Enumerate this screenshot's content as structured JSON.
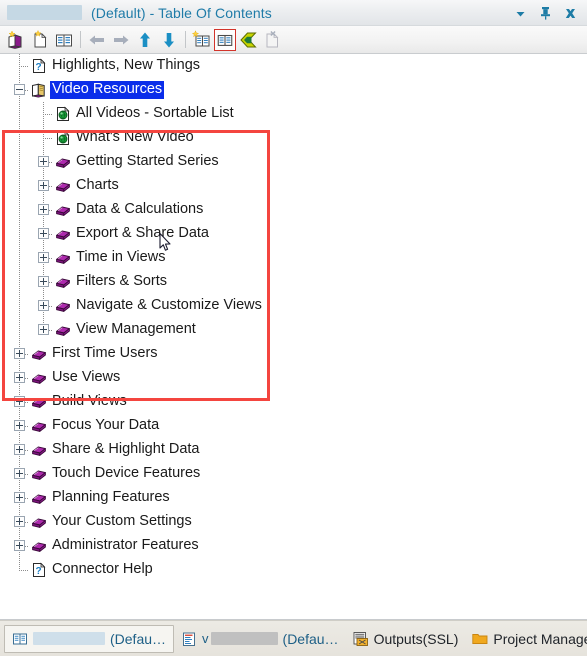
{
  "window": {
    "title_suffix": "(Default) - Table Of Contents",
    "redacted_title": "",
    "controls": [
      {
        "name": "dropdown-menu",
        "label": "Window menu"
      },
      {
        "name": "auto-hide-pin",
        "label": "Auto Hide"
      },
      {
        "name": "close",
        "label": "Close"
      }
    ]
  },
  "toolbar": {
    "items": [
      {
        "name": "new-book-icon",
        "label": "New Book",
        "enabled": true
      },
      {
        "name": "new-page-icon",
        "label": "New Page",
        "enabled": true
      },
      {
        "name": "show-contents-icon",
        "label": "Show Contents",
        "enabled": true
      },
      {
        "name": "back-arrow-icon",
        "label": "Back",
        "enabled": false
      },
      {
        "name": "forward-arrow-icon",
        "label": "Forward",
        "enabled": false
      },
      {
        "name": "move-up-icon",
        "label": "Move Up",
        "enabled": true
      },
      {
        "name": "move-down-icon",
        "label": "Move Down",
        "enabled": true
      },
      {
        "name": "new-topic-icon",
        "label": "New Topic",
        "enabled": true
      },
      {
        "name": "toggle-book-icon",
        "label": "Synchronize Contents",
        "enabled": true,
        "active": true
      },
      {
        "name": "bookmark-icon",
        "label": "Bookmark",
        "enabled": true
      },
      {
        "name": "delete-page-icon",
        "label": "Delete Page",
        "enabled": false
      }
    ]
  },
  "tree": {
    "nodes": [
      {
        "label": "Highlights, New Things",
        "icon": "help-page-icon",
        "depth": 0,
        "state": "leaf",
        "selected": false
      },
      {
        "label": "Video Resources",
        "icon": "open-book-icon",
        "depth": 0,
        "state": "expanded",
        "selected": true
      },
      {
        "label": "All Videos - Sortable List",
        "icon": "globe-page-icon",
        "depth": 1,
        "state": "leaf",
        "selected": false
      },
      {
        "label": "What's New Video",
        "icon": "globe-page-icon",
        "depth": 1,
        "state": "leaf",
        "selected": false
      },
      {
        "label": "Getting Started Series",
        "icon": "book-icon",
        "depth": 1,
        "state": "collapsed",
        "selected": false
      },
      {
        "label": "Charts",
        "icon": "book-icon",
        "depth": 1,
        "state": "collapsed",
        "selected": false
      },
      {
        "label": "Data & Calculations",
        "icon": "book-icon",
        "depth": 1,
        "state": "collapsed",
        "selected": false
      },
      {
        "label": "Export & Share Data",
        "icon": "book-icon",
        "depth": 1,
        "state": "collapsed",
        "selected": false
      },
      {
        "label": "Time in Views",
        "icon": "book-icon",
        "depth": 1,
        "state": "collapsed",
        "selected": false
      },
      {
        "label": "Filters & Sorts",
        "icon": "book-icon",
        "depth": 1,
        "state": "collapsed",
        "selected": false
      },
      {
        "label": "Navigate & Customize Views",
        "icon": "book-icon",
        "depth": 1,
        "state": "collapsed",
        "selected": false
      },
      {
        "label": "View Management",
        "icon": "book-icon",
        "depth": 1,
        "state": "collapsed",
        "selected": false
      },
      {
        "label": "First Time Users",
        "icon": "book-icon",
        "depth": 0,
        "state": "collapsed",
        "selected": false
      },
      {
        "label": "Use Views",
        "icon": "book-icon",
        "depth": 0,
        "state": "collapsed",
        "selected": false
      },
      {
        "label": "Build Views",
        "icon": "book-icon",
        "depth": 0,
        "state": "collapsed",
        "selected": false
      },
      {
        "label": "Focus Your Data",
        "icon": "book-icon",
        "depth": 0,
        "state": "collapsed",
        "selected": false
      },
      {
        "label": "Share & Highlight Data",
        "icon": "book-icon",
        "depth": 0,
        "state": "collapsed",
        "selected": false
      },
      {
        "label": "Touch Device Features",
        "icon": "book-icon",
        "depth": 0,
        "state": "collapsed",
        "selected": false
      },
      {
        "label": "Planning Features",
        "icon": "book-icon",
        "depth": 0,
        "state": "collapsed",
        "selected": false
      },
      {
        "label": "Your Custom Settings",
        "icon": "book-icon",
        "depth": 0,
        "state": "collapsed",
        "selected": false
      },
      {
        "label": "Administrator Features",
        "icon": "book-icon",
        "depth": 0,
        "state": "collapsed",
        "selected": false
      },
      {
        "label": "Connector Help",
        "icon": "help-page-icon",
        "depth": 0,
        "state": "leaf",
        "selected": false
      }
    ]
  },
  "annotation": {
    "name": "red-highlight-rectangle",
    "color": "#f4453f"
  },
  "taskbar": {
    "buttons": [
      {
        "name": "taskbar-item-contents",
        "icon": "contents-icon",
        "redacted": "blue",
        "label": "(Defau…",
        "active": true
      },
      {
        "name": "taskbar-item-document",
        "icon": "document-icon",
        "prefix": "v",
        "redacted": "grey",
        "label": "(Defau…",
        "active": false
      },
      {
        "name": "taskbar-item-outputs",
        "icon": "outputs-icon",
        "label": "Outputs(SSL)",
        "active": false
      },
      {
        "name": "taskbar-item-project-manager",
        "icon": "folder-icon",
        "label": "Project Manager",
        "active": false
      }
    ]
  },
  "colors": {
    "title_text": "#1f7ba8",
    "selection": "#0a2dea",
    "book_purple": "#8b1a8b",
    "annotation_red": "#f4453f",
    "arrow_blue": "#1b8fc4"
  }
}
